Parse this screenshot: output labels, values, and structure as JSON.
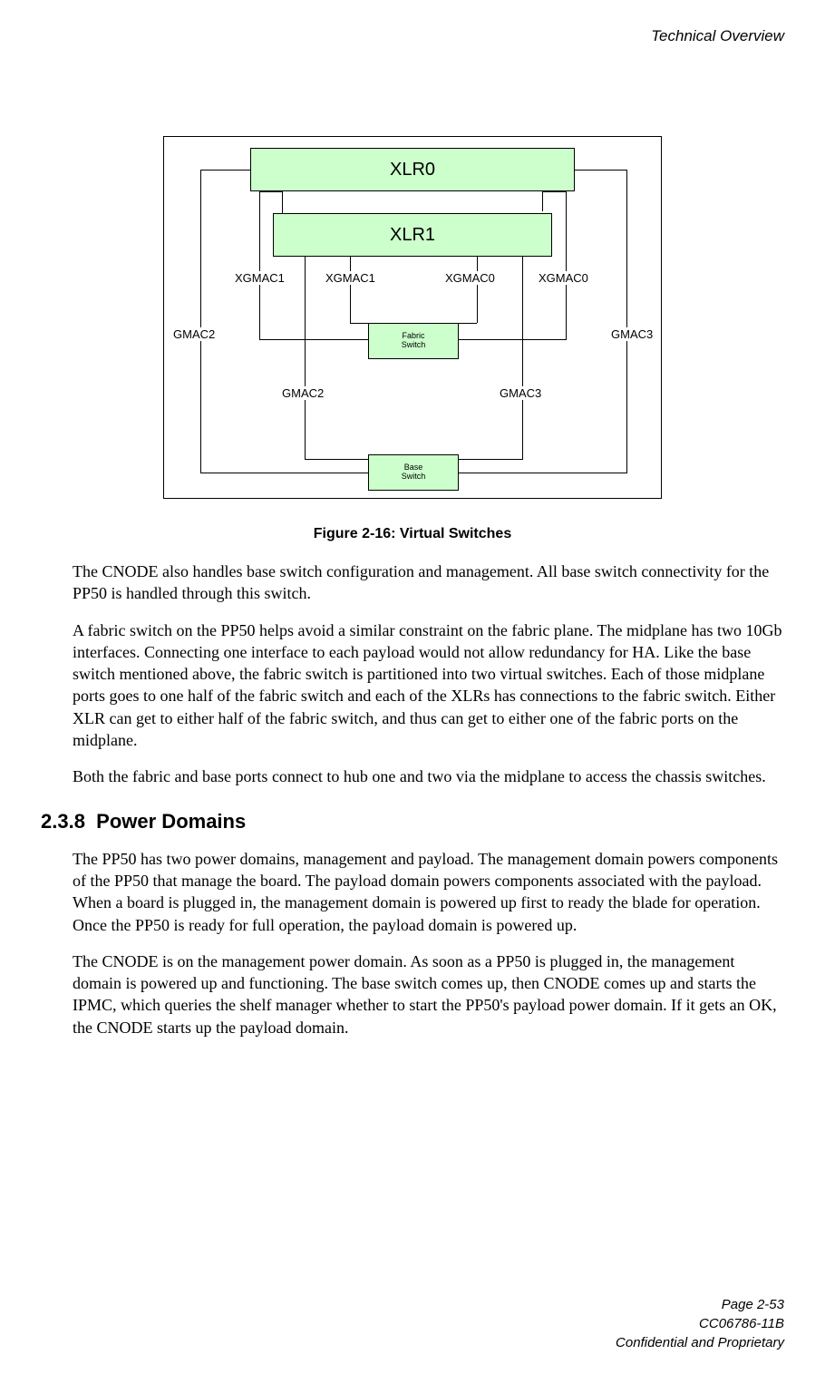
{
  "header": {
    "section_title": "Technical Overview"
  },
  "diagram": {
    "xlr0": "XLR0",
    "xlr1": "XLR1",
    "fabric_l1": "Fabric",
    "fabric_l2": "Switch",
    "base_l1": "Base",
    "base_l2": "Switch",
    "labels": {
      "xgmac1_outer": "XGMAC1",
      "xgmac1_inner": "XGMAC1",
      "xgmac0_inner": "XGMAC0",
      "xgmac0_outer": "XGMAC0",
      "gmac2_outer": "GMAC2",
      "gmac2_inner": "GMAC2",
      "gmac3_inner": "GMAC3",
      "gmac3_outer": "GMAC3"
    }
  },
  "figure_caption": "Figure 2-16: Virtual Switches",
  "paragraphs": {
    "p1": "The CNODE also handles base switch configuration and management. All base switch connectivity for the PP50 is handled through this switch.",
    "p2": "A fabric switch on the PP50 helps avoid a similar constraint on the fabric plane. The midplane has two 10Gb interfaces. Connecting one interface to each payload would not allow redundancy for HA. Like the base switch mentioned above, the fabric switch is partitioned into two virtual switches. Each of those midplane ports goes to one half of the fabric switch and each of the XLRs has connections to the fabric switch. Either XLR can get to either half of the fabric switch, and thus can get to either one of the fabric ports on the midplane.",
    "p3": "Both the fabric and base ports connect to hub one and two via the midplane to access the chassis switches."
  },
  "section": {
    "number": "2.3.8",
    "title": "Power Domains",
    "p1": "The PP50 has two power domains, management and payload. The management domain powers components of the PP50 that manage the board. The payload domain powers components associated with the payload. When a board is plugged in, the management domain is powered up first to ready the blade for operation. Once the PP50 is ready for full operation, the payload domain is powered up.",
    "p2": "The CNODE is on the management power domain. As soon as a PP50 is plugged in, the management domain is powered up and functioning. The base switch comes up, then CNODE comes up and starts the IPMC, which queries the shelf manager whether to start the PP50's payload power domain. If it gets an OK, the CNODE starts up the payload domain."
  },
  "footer": {
    "page": "Page 2-53",
    "docid": "CC06786-11B",
    "confidential": "Confidential and Proprietary"
  }
}
